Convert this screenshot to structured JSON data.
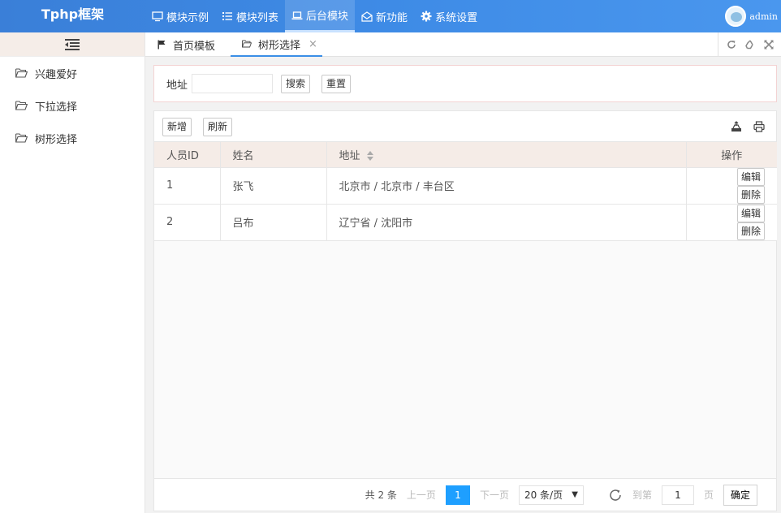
{
  "header": {
    "logo": "Tphp框架",
    "nav": [
      {
        "label": "模块示例",
        "icon": "monitor-icon"
      },
      {
        "label": "模块列表",
        "icon": "list-icon"
      },
      {
        "label": "后台模块",
        "icon": "laptop-icon",
        "active": true
      },
      {
        "label": "新功能",
        "icon": "envelope-open-icon"
      },
      {
        "label": "系统设置",
        "icon": "gear-icon"
      }
    ],
    "user": "admin",
    "accent": "#3a8ee6"
  },
  "sidebar": {
    "toggle_icon": "indent-icon",
    "items": [
      {
        "label": "兴趣爱好",
        "icon": "folder-open-icon"
      },
      {
        "label": "下拉选择",
        "icon": "folder-open-icon"
      },
      {
        "label": "树形选择",
        "icon": "folder-open-icon"
      }
    ]
  },
  "tabs": {
    "home": "首页模板",
    "current": "树形选择",
    "close": "×"
  },
  "search": {
    "label": "地址",
    "value": "",
    "search_button": "搜索",
    "reset_button": "重置"
  },
  "toolbar": {
    "add": "新增",
    "refresh": "刷新"
  },
  "table": {
    "columns": [
      "人员ID",
      "姓名",
      "地址",
      "操作"
    ],
    "rows": [
      {
        "id": "1",
        "name": "张飞",
        "address": "北京市 / 北京市 / 丰台区",
        "edit": "编辑",
        "delete": "删除"
      },
      {
        "id": "2",
        "name": "吕布",
        "address": "辽宁省 / 沈阳市",
        "edit": "编辑",
        "delete": "删除"
      }
    ]
  },
  "pager": {
    "total": "共 2 条",
    "prev": "上一页",
    "current": "1",
    "next": "下一页",
    "page_size": "20 条/页",
    "goto_label": "到第",
    "goto_value": "1",
    "page_unit": "页",
    "confirm": "确定",
    "current_color": "#1e9fff"
  }
}
